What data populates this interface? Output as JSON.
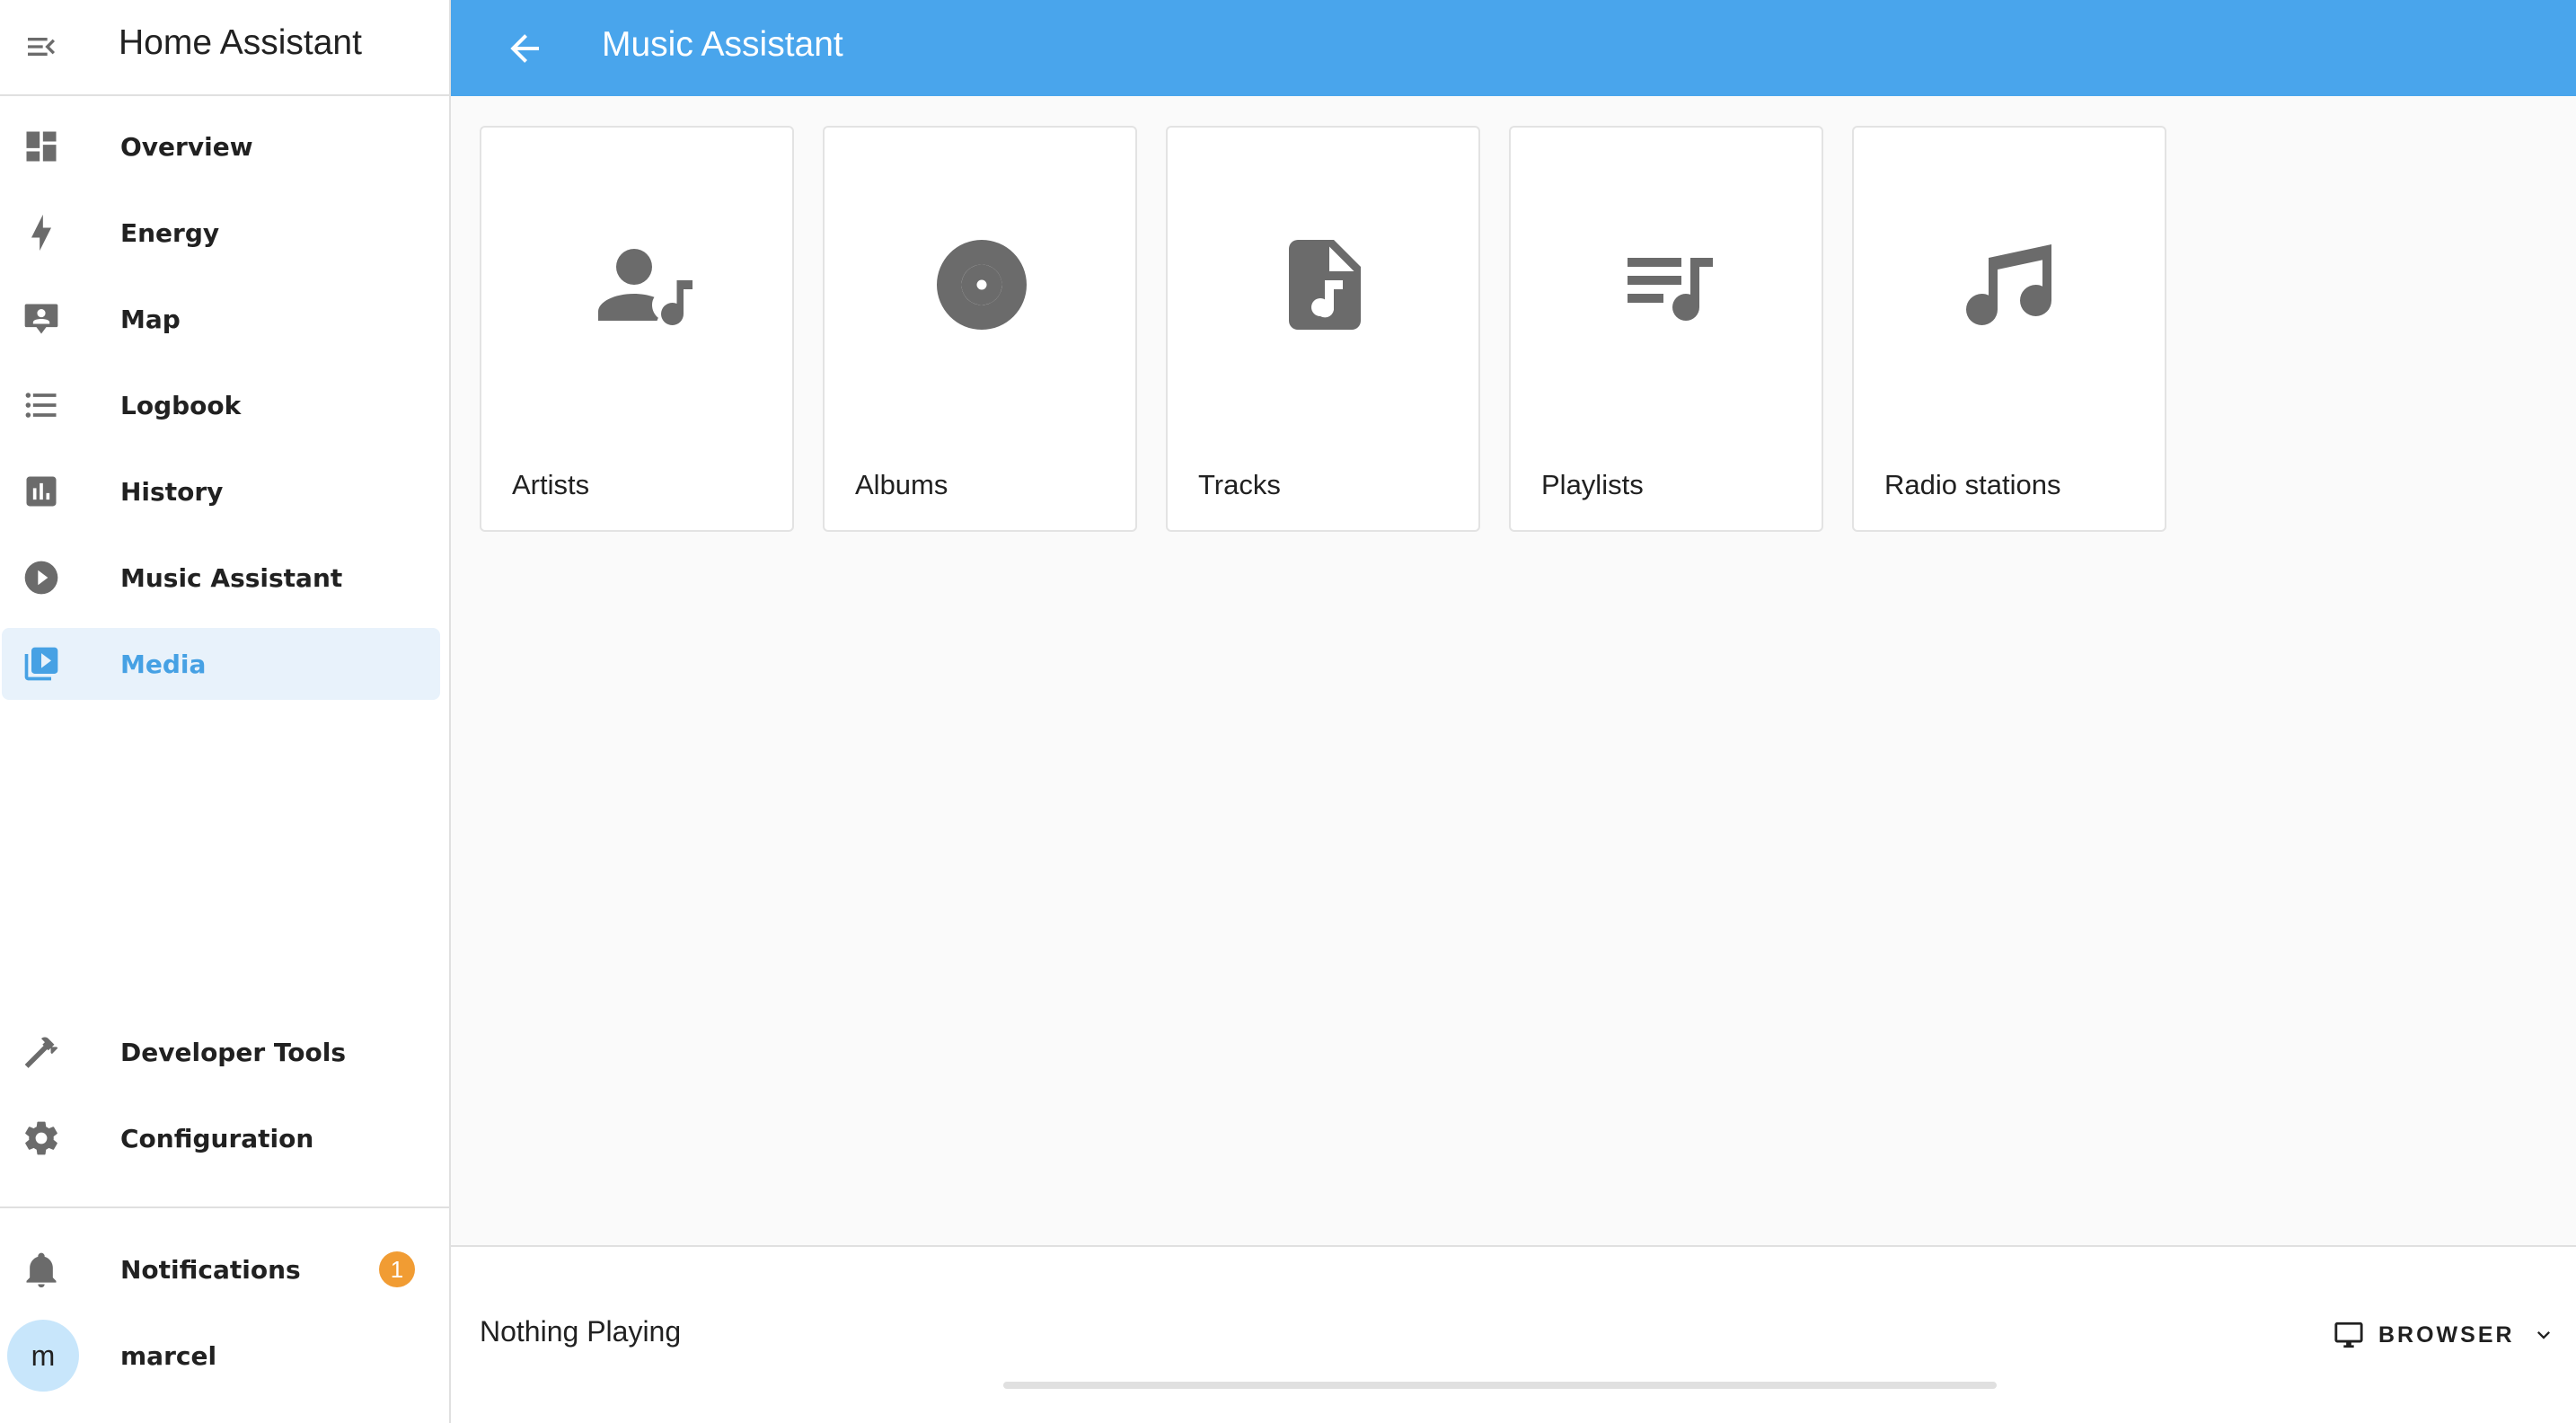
{
  "app": {
    "title": "Home Assistant"
  },
  "sidebar": {
    "items": [
      {
        "label": "Overview",
        "icon": "dashboard-icon"
      },
      {
        "label": "Energy",
        "icon": "lightning-bolt-icon"
      },
      {
        "label": "Map",
        "icon": "map-account-icon"
      },
      {
        "label": "Logbook",
        "icon": "format-list-bulleted-icon"
      },
      {
        "label": "History",
        "icon": "chart-box-icon"
      },
      {
        "label": "Music Assistant",
        "icon": "play-circle-icon"
      },
      {
        "label": "Media",
        "icon": "play-box-multiple-icon",
        "active": true
      }
    ],
    "bottom_items": [
      {
        "label": "Developer Tools",
        "icon": "hammer-icon"
      },
      {
        "label": "Configuration",
        "icon": "gear-icon"
      }
    ],
    "notifications": {
      "label": "Notifications",
      "count": "1",
      "icon": "bell-icon"
    },
    "user": {
      "name": "marcel",
      "initial": "m"
    }
  },
  "header": {
    "title": "Music Assistant"
  },
  "categories": [
    {
      "label": "Artists",
      "icon": "account-music-icon"
    },
    {
      "label": "Albums",
      "icon": "album-icon"
    },
    {
      "label": "Tracks",
      "icon": "file-music-icon"
    },
    {
      "label": "Playlists",
      "icon": "playlist-music-icon"
    },
    {
      "label": "Radio stations",
      "icon": "music-note-icon"
    }
  ],
  "player": {
    "status": "Nothing Playing",
    "target_label": "BROWSER",
    "progress": 0
  },
  "colors": {
    "accent": "#49a5ec",
    "active_text": "#46a1e4",
    "active_bg": "#e8f2fb",
    "badge": "#f19c33",
    "icon": "#6b6b6b"
  }
}
